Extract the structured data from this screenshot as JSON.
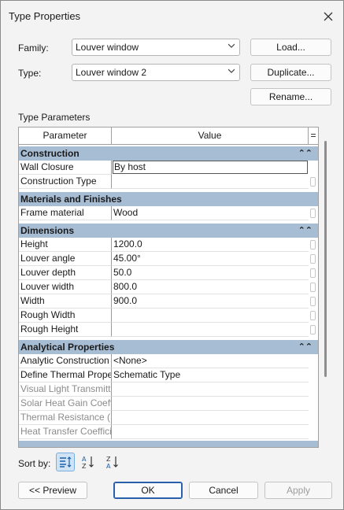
{
  "window": {
    "title": "Type Properties"
  },
  "family": {
    "label": "Family:",
    "value": "Louver window"
  },
  "type": {
    "label": "Type:",
    "value": "Louver window 2"
  },
  "buttons": {
    "load": "Load...",
    "duplicate": "Duplicate...",
    "rename": "Rename...",
    "preview": "<< Preview",
    "ok": "OK",
    "cancel": "Cancel",
    "apply": "Apply"
  },
  "parameters_label": "Type Parameters",
  "grid": {
    "header": {
      "parameter": "Parameter",
      "value": "Value",
      "eq": "="
    },
    "groups": [
      {
        "name": "Construction",
        "rows": [
          {
            "param": "Wall Closure",
            "value": "By host"
          },
          {
            "param": "Construction Type",
            "value": ""
          }
        ]
      },
      {
        "name": "Materials and Finishes",
        "rows": [
          {
            "param": "Frame material",
            "value": "Wood"
          }
        ]
      },
      {
        "name": "Dimensions",
        "rows": [
          {
            "param": "Height",
            "value": "1200.0"
          },
          {
            "param": "Louver angle",
            "value": "45.00°"
          },
          {
            "param": "Louver depth",
            "value": "50.0"
          },
          {
            "param": "Louver width",
            "value": "800.0"
          },
          {
            "param": "Width",
            "value": "900.0"
          },
          {
            "param": "Rough Width",
            "value": ""
          },
          {
            "param": "Rough Height",
            "value": ""
          }
        ]
      },
      {
        "name": "Analytical Properties",
        "rows": [
          {
            "param": "Analytic Construction",
            "value": "<None>"
          },
          {
            "param": "Define Thermal Properties by",
            "value": "Schematic Type"
          },
          {
            "param": "Visual Light Transmittance",
            "value": ""
          },
          {
            "param": "Solar Heat Gain Coefficient",
            "value": ""
          },
          {
            "param": "Thermal Resistance (R)",
            "value": ""
          },
          {
            "param": "Heat Transfer Coefficient (U)",
            "value": ""
          }
        ]
      }
    ]
  },
  "sort": {
    "label": "Sort by:"
  },
  "colors": {
    "group_header": "#a7bdd4",
    "accent": "#2a5fab"
  }
}
